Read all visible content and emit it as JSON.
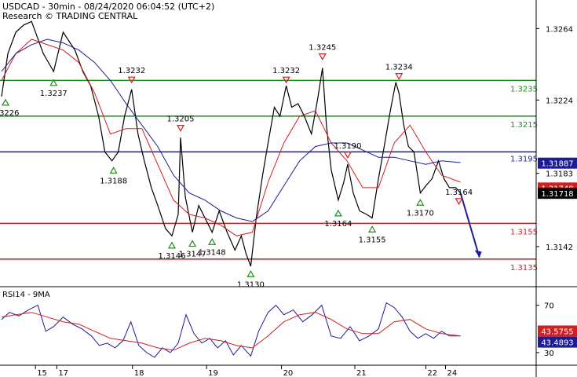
{
  "header": {
    "line1": "USDCAD - 30min - 08/24/2020 06:04:52 (UTC+2)",
    "line2": "Research © TRADING CENTRAL"
  },
  "chart_data": [
    {
      "type": "line",
      "panel": "price",
      "title": "",
      "ylim": [
        1.312,
        1.328
      ],
      "yticks": [
        "1.3264",
        "1.3224",
        "1.3183",
        "1.3142"
      ],
      "yticks_values": [
        1.3264,
        1.3224,
        1.3183,
        1.3142
      ],
      "x_day_labels": [
        "15",
        "17",
        "18",
        "19",
        "20",
        "21",
        "22",
        "24"
      ],
      "x_day_index": [
        45,
        72,
        168,
        262,
        357,
        450,
        540,
        565
      ],
      "x_range": [
        0,
        680
      ],
      "levels": [
        {
          "value": 1.3235,
          "label": "1.3235",
          "color": "#1e8c1e",
          "kind": "resistance"
        },
        {
          "value": 1.3215,
          "label": "1.3215",
          "color": "#1e8c1e",
          "kind": "resistance"
        },
        {
          "value": 1.3195,
          "label": "1.3195",
          "color": "#1c1c96",
          "kind": "pivot"
        },
        {
          "value": 1.3155,
          "label": "1.3155",
          "color": "#d21e1e",
          "kind": "support"
        },
        {
          "value": 1.3135,
          "label": "1.3135",
          "color": "#d21e1e",
          "kind": "support"
        }
      ],
      "current_tags": [
        {
          "value": 1.31887,
          "label": "1.31887",
          "bg": "#1c1c96",
          "fg": "#ffffff"
        },
        {
          "value": 1.31748,
          "label": "1.31748",
          "bg": "#d21e1e",
          "fg": "#ffffff"
        },
        {
          "value": 1.31718,
          "label": "1.31718",
          "bg": "#000000",
          "fg": "#ffffff"
        }
      ],
      "pivots": [
        {
          "x": 7,
          "value": 1.3226,
          "label": "1.3226",
          "kind": "low"
        },
        {
          "x": 68,
          "value": 1.3237,
          "label": "1.3237",
          "kind": "low"
        },
        {
          "x": 167,
          "value": 1.3232,
          "label": "1.3232",
          "kind": "high"
        },
        {
          "x": 144,
          "value": 1.3188,
          "label": "1.3188",
          "kind": "low"
        },
        {
          "x": 229,
          "value": 1.3205,
          "label": "1.3205",
          "kind": "high"
        },
        {
          "x": 218,
          "value": 1.3146,
          "label": "1.3146",
          "kind": "low"
        },
        {
          "x": 244,
          "value": 1.3147,
          "label": "1.3147",
          "kind": "low"
        },
        {
          "x": 269,
          "value": 1.3148,
          "label": "1.3148",
          "kind": "low"
        },
        {
          "x": 318,
          "value": 1.313,
          "label": "1.3130",
          "kind": "low"
        },
        {
          "x": 363,
          "value": 1.3232,
          "label": "1.3232",
          "kind": "high"
        },
        {
          "x": 409,
          "value": 1.3245,
          "label": "1.3245",
          "kind": "high"
        },
        {
          "x": 441,
          "value": 1.319,
          "label": "1.3190",
          "kind": "high"
        },
        {
          "x": 429,
          "value": 1.3164,
          "label": "1.3164",
          "kind": "low"
        },
        {
          "x": 472,
          "value": 1.3155,
          "label": "1.3155",
          "kind": "low"
        },
        {
          "x": 506,
          "value": 1.3234,
          "label": "1.3234",
          "kind": "high"
        },
        {
          "x": 533,
          "value": 1.317,
          "label": "1.3170",
          "kind": "low"
        },
        {
          "x": 582,
          "value": 1.3164,
          "label": "1.3164",
          "kind": "high"
        }
      ],
      "series": [
        {
          "name": "",
          "color": "#000000",
          "x": [
            2,
            10,
            20,
            30,
            40,
            55,
            68,
            80,
            95,
            105,
            115,
            125,
            133,
            142,
            150,
            158,
            167,
            175,
            183,
            192,
            200,
            210,
            218,
            226,
            229,
            235,
            244,
            252,
            260,
            269,
            278,
            288,
            298,
            306,
            312,
            318,
            325,
            333,
            340,
            348,
            355,
            363,
            370,
            378,
            386,
            395,
            403,
            409,
            414,
            420,
            429,
            436,
            441,
            448,
            456,
            465,
            472,
            480,
            488,
            495,
            502,
            506,
            512,
            518,
            525,
            533,
            540,
            548,
            556,
            563,
            570,
            578,
            584
          ],
          "values": [
            1.3226,
            1.325,
            1.3262,
            1.3266,
            1.3268,
            1.325,
            1.324,
            1.3262,
            1.3252,
            1.324,
            1.3232,
            1.3215,
            1.3195,
            1.319,
            1.3195,
            1.3215,
            1.323,
            1.3205,
            1.319,
            1.3175,
            1.3165,
            1.3152,
            1.3148,
            1.316,
            1.3203,
            1.317,
            1.315,
            1.3165,
            1.3158,
            1.315,
            1.3162,
            1.315,
            1.314,
            1.3148,
            1.3138,
            1.3131,
            1.3158,
            1.3182,
            1.32,
            1.322,
            1.3215,
            1.3232,
            1.322,
            1.3222,
            1.3215,
            1.3205,
            1.3225,
            1.3242,
            1.321,
            1.3185,
            1.3168,
            1.3178,
            1.3188,
            1.3172,
            1.3162,
            1.316,
            1.3158,
            1.318,
            1.32,
            1.3218,
            1.3234,
            1.3228,
            1.321,
            1.3198,
            1.3195,
            1.3172,
            1.3176,
            1.318,
            1.319,
            1.318,
            1.3175,
            1.3175,
            1.3172
          ]
        },
        {
          "name": "",
          "color": "#d21e1e",
          "x": [
            2,
            20,
            40,
            60,
            80,
            100,
            120,
            140,
            160,
            180,
            200,
            220,
            240,
            260,
            280,
            300,
            320,
            340,
            360,
            380,
            400,
            420,
            440,
            460,
            480,
            500,
            520,
            540,
            560,
            584
          ],
          "values": [
            1.3235,
            1.325,
            1.3258,
            1.3255,
            1.3252,
            1.3245,
            1.3228,
            1.3205,
            1.3208,
            1.3208,
            1.3188,
            1.3168,
            1.316,
            1.3158,
            1.3154,
            1.3148,
            1.315,
            1.3178,
            1.32,
            1.3215,
            1.3218,
            1.32,
            1.319,
            1.3175,
            1.3175,
            1.32,
            1.321,
            1.3195,
            1.3182,
            1.3178
          ]
        },
        {
          "name": "",
          "color": "#1c1c96",
          "x": [
            2,
            20,
            40,
            60,
            80,
            100,
            120,
            140,
            160,
            180,
            200,
            220,
            240,
            260,
            280,
            300,
            320,
            340,
            360,
            380,
            400,
            420,
            440,
            460,
            480,
            500,
            520,
            540,
            560,
            584
          ],
          "values": [
            1.324,
            1.325,
            1.3255,
            1.3258,
            1.3256,
            1.3252,
            1.3245,
            1.3235,
            1.3222,
            1.321,
            1.3198,
            1.3182,
            1.3172,
            1.3168,
            1.3162,
            1.3158,
            1.3156,
            1.3162,
            1.3176,
            1.319,
            1.3198,
            1.32,
            1.32,
            1.3196,
            1.3192,
            1.3192,
            1.319,
            1.3188,
            1.319,
            1.3189
          ]
        },
        {
          "name": "",
          "color": "#1c1c96",
          "x": [
            584,
            608
          ],
          "values": [
            1.3172,
            1.3136
          ]
        }
      ]
    },
    {
      "type": "line",
      "panel": "rsi",
      "title": "RSI14 - 9MA",
      "ylim": [
        20,
        85
      ],
      "yticks": [
        "70",
        "30"
      ],
      "yticks_values": [
        70,
        30
      ],
      "current_tags": [
        {
          "value": 43.5755,
          "label": "43.5755",
          "bg": "#d21e1e",
          "fg": "#ffffff"
        },
        {
          "value": 43.4893,
          "label": "43.4893",
          "bg": "#1c1c96",
          "fg": "#ffffff"
        }
      ],
      "series": [
        {
          "name": "RSI14",
          "color": "#1c1c96",
          "x": [
            2,
            12,
            24,
            36,
            48,
            58,
            68,
            80,
            92,
            104,
            116,
            126,
            136,
            146,
            156,
            166,
            176,
            186,
            196,
            206,
            216,
            226,
            236,
            246,
            256,
            266,
            276,
            286,
            296,
            306,
            318,
            328,
            340,
            350,
            360,
            372,
            384,
            396,
            408,
            420,
            432,
            444,
            456,
            468,
            480,
            490,
            500,
            510,
            520,
            530,
            540,
            550,
            560,
            570,
            584
          ],
          "values": [
            58,
            64,
            61,
            66,
            70,
            48,
            52,
            60,
            54,
            50,
            44,
            36,
            38,
            34,
            40,
            56,
            36,
            30,
            26,
            34,
            30,
            38,
            62,
            46,
            38,
            42,
            34,
            40,
            28,
            36,
            27,
            48,
            64,
            70,
            62,
            66,
            56,
            62,
            70,
            44,
            42,
            52,
            40,
            44,
            50,
            72,
            68,
            60,
            48,
            42,
            46,
            42,
            48,
            44,
            44
          ]
        },
        {
          "name": "9MA",
          "color": "#d21e1e",
          "x": [
            2,
            20,
            40,
            60,
            80,
            100,
            120,
            140,
            160,
            180,
            200,
            220,
            240,
            260,
            280,
            300,
            320,
            340,
            360,
            380,
            400,
            420,
            440,
            460,
            480,
            500,
            520,
            540,
            560,
            584
          ],
          "values": [
            60,
            62,
            64,
            60,
            56,
            54,
            48,
            42,
            40,
            38,
            34,
            32,
            38,
            42,
            40,
            36,
            34,
            44,
            56,
            62,
            64,
            58,
            50,
            46,
            46,
            56,
            58,
            50,
            46,
            44
          ]
        }
      ]
    }
  ]
}
